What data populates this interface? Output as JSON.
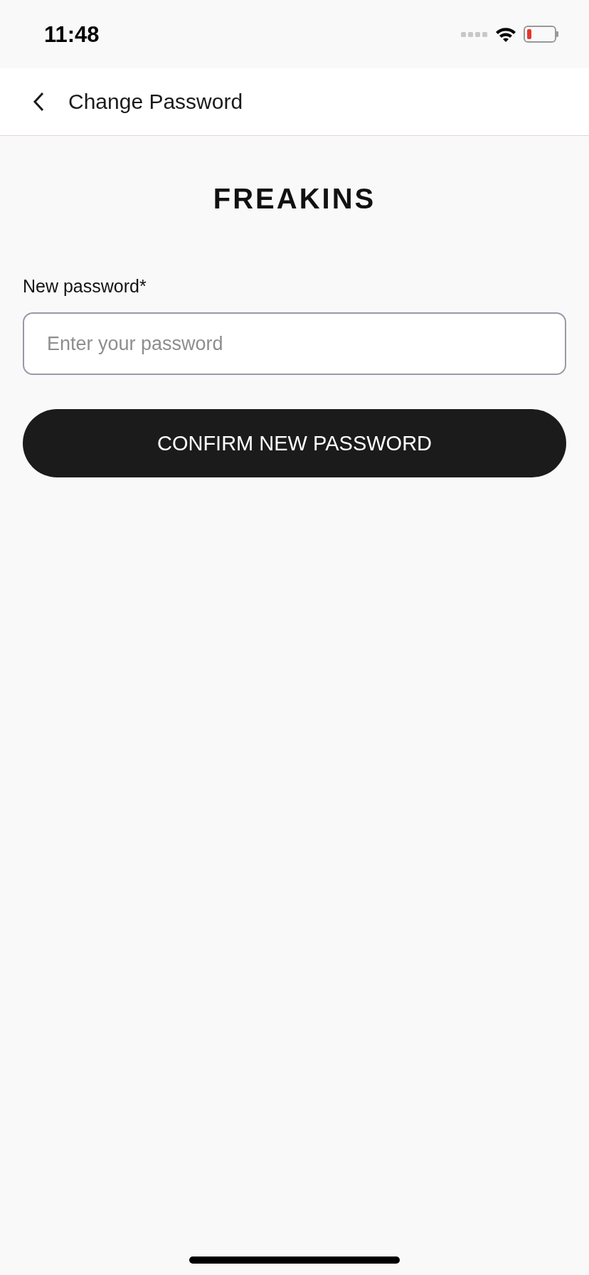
{
  "status_bar": {
    "time": "11:48"
  },
  "header": {
    "title": "Change Password"
  },
  "logo": "FREAKINS",
  "form": {
    "label": "New password*",
    "placeholder": "Enter your password"
  },
  "button": "CONFIRM NEW PASSWORD"
}
